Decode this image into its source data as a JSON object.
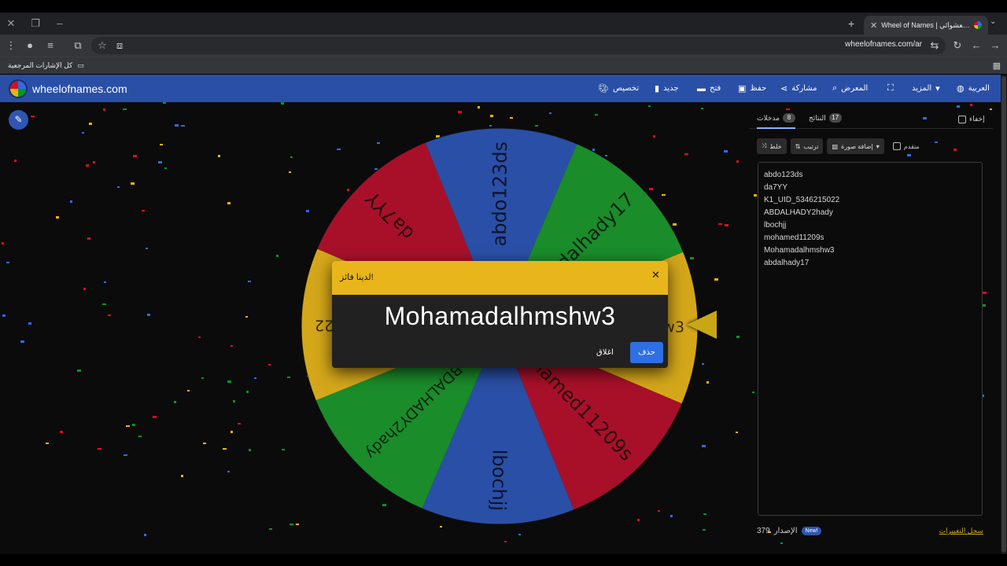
{
  "browser": {
    "tab_title": "Wheel of Names | عجلة الاسم العشوائي",
    "url": "wheelofnames.com/ar",
    "bookmarks_label": "كل الإشارات المرجعية"
  },
  "header": {
    "brand": "wheelofnames.com",
    "nav": {
      "customize": "تخصيص",
      "new": "جديد",
      "open": "فتح",
      "save": "حفظ",
      "share": "مشاركة",
      "gallery": "المعرض",
      "more": "المزيد",
      "language": "العربية"
    }
  },
  "wheel": {
    "segments": [
      {
        "label": "abdo123ds",
        "color": "#2a4fa7"
      },
      {
        "label": "abdalhady17",
        "color": "#1a8c2a"
      },
      {
        "label": "Mohamadalhmshw3",
        "color": "#d4a71a"
      },
      {
        "label": "mohamed11209s",
        "color": "#a8102a"
      },
      {
        "label": "lbochjj",
        "color": "#2a4fa7"
      },
      {
        "label": "ABDALHADY2hady",
        "color": "#1a8c2a"
      },
      {
        "label": "K1_UID_5346215022",
        "color": "#d4a71a"
      },
      {
        "label": "da7YY",
        "color": "#a8102a"
      }
    ]
  },
  "dialog": {
    "title": "لدينا فائز!",
    "winner": "Mohamadalhmshw3",
    "close_label": "اغلاق",
    "remove_label": "حذف"
  },
  "panel": {
    "tabs": {
      "entries_label": "مدخلات",
      "entries_count": "8",
      "results_label": "النتائج",
      "results_count": "17"
    },
    "hide_label": "إخفاء",
    "shuffle_label": "خلط",
    "sort_label": "ترتيب",
    "add_image_label": "إضافة صورة",
    "advanced_label": "متقدم",
    "entries": [
      "abdo123ds",
      "da7YY",
      "K1_UID_5346215022",
      "ABDALHADY2hady",
      "lbochjj",
      "mohamed11209s",
      "Mohamadalhmshw3",
      "abdalhady17"
    ],
    "version_label": "الإصدار",
    "version_number": "379",
    "new_badge": "New!",
    "changelog_label": "سجل التغييرات"
  }
}
